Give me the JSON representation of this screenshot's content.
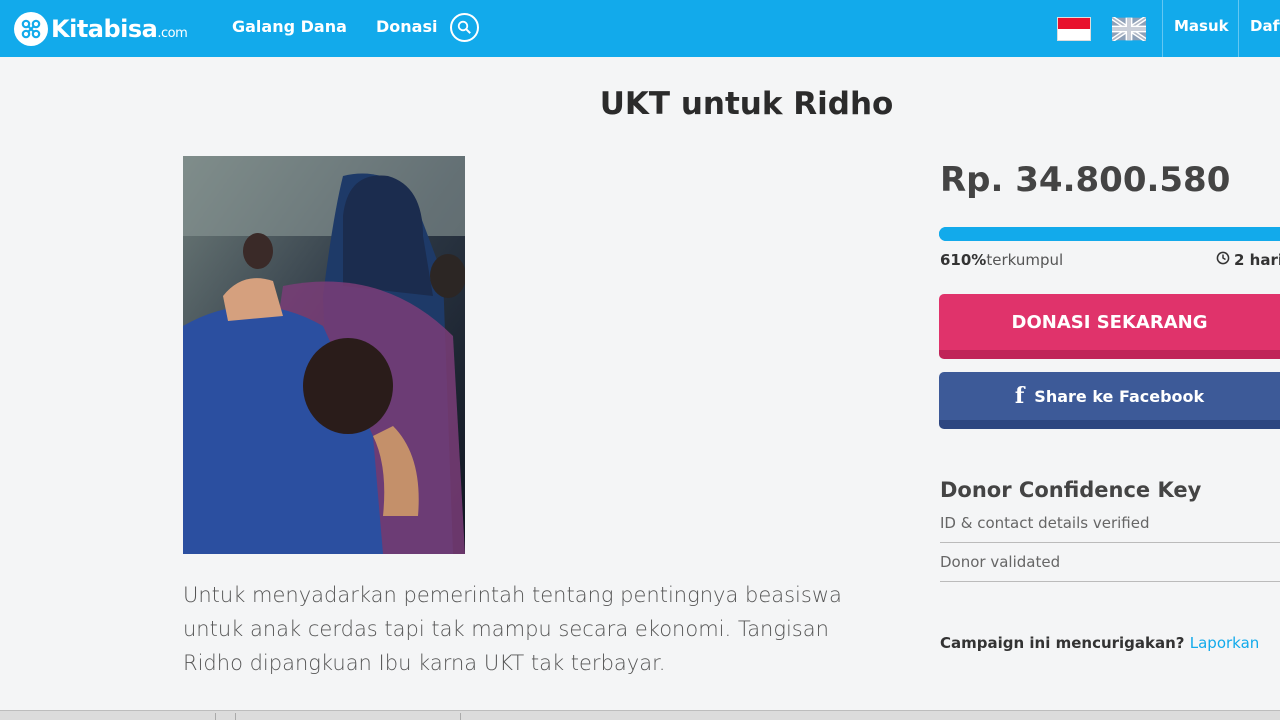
{
  "header": {
    "logo_text": "Kitabisa",
    "logo_suffix": ".com",
    "nav": {
      "galang_dana": "Galang Dana",
      "donasi": "Donasi"
    },
    "masuk": "Masuk",
    "daftar": "Daft",
    "colors": {
      "bar": "#12aaeb"
    },
    "icons": [
      "kitabisa-logo-icon",
      "search-icon",
      "flag-indonesia-icon",
      "flag-uk-icon"
    ]
  },
  "campaign": {
    "title": "UKT untuk Ridho",
    "description": "Untuk menyadarkan pemerintah tentang pentingnya beasiswa untuk anak cerdas tapi tak mampu secara ekonomi. Tangisan Ridho dipangkuan Ibu karna UKT tak terbayar.",
    "amount": "Rp. 34.800.580",
    "progress_fraction": 1.0,
    "percent_value": "610%",
    "percent_label": "terkumpul",
    "days_value": "2 hari",
    "donate_button": "DONASI SEKARANG",
    "facebook_button": "Share ke Facebook",
    "colors": {
      "donate": "#e0336b",
      "facebook": "#3d5a98",
      "progress": "#12aaeb"
    }
  },
  "donor_confidence": {
    "title": "Donor Confidence Key",
    "items": [
      "ID & contact details verified",
      "Donor validated"
    ]
  },
  "report": {
    "question": "Campaign ini mencurigakan?",
    "link": "Laporkan"
  }
}
